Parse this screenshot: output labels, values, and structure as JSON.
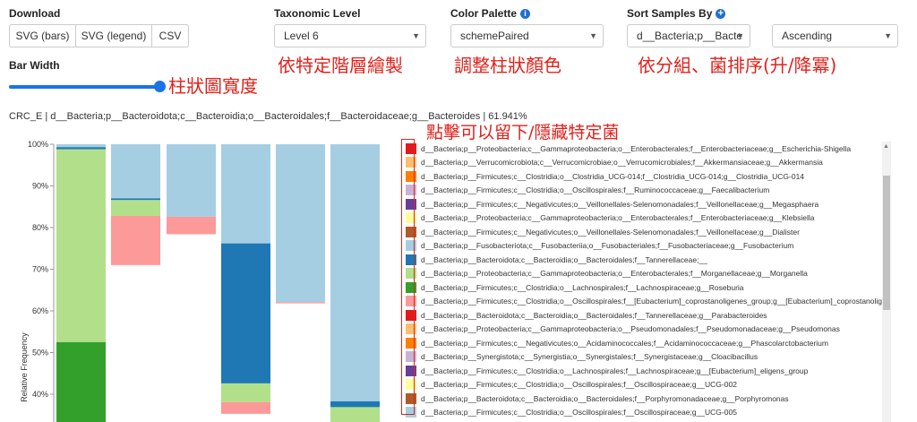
{
  "download": {
    "label": "Download",
    "buttons": [
      "SVG (bars)",
      "SVG (legend)",
      "CSV"
    ]
  },
  "taxonomic_level": {
    "label": "Taxonomic Level",
    "value": "Level 6"
  },
  "color_palette": {
    "label": "Color Palette",
    "value": "schemePaired"
  },
  "sort_samples": {
    "label": "Sort Samples By",
    "value": "d__Bacteria;p__Bacte",
    "order": "Ascending"
  },
  "bar_width": {
    "label": "Bar Width",
    "level": 1.0
  },
  "annotations": {
    "bar_width": "柱狀圖寬度",
    "taxonomic_level": "依特定階層繪製",
    "color_palette": "調整柱狀顏色",
    "sort": "依分組、菌排序(升/降冪)",
    "legend": "點擊可以留下/隱藏特定菌"
  },
  "hover_text": "CRC_E | d__Bacteria;p__Bacteroidota;c__Bacteroidia;o__Bacteroidales;f__Bacteroidaceae;g__Bacteroides | 61.941%",
  "icons": {
    "info": "info-icon",
    "plus": "plus-circle-icon"
  },
  "chart_data": {
    "type": "bar",
    "stacked": true,
    "ylabel": "Relative Frequency",
    "yticks": [
      "100%",
      "90%",
      "80%",
      "70%",
      "60%",
      "50%",
      "40%"
    ],
    "ylim_visible": [
      34.5,
      100
    ],
    "segments": [
      {
        "sample": 0,
        "y0": 99.3,
        "y1": 100,
        "color": "#a6cee3"
      },
      {
        "sample": 0,
        "y0": 98.8,
        "y1": 99.3,
        "color": "#1f78b4"
      },
      {
        "sample": 0,
        "y0": 52.5,
        "y1": 98.8,
        "color": "#b2df8a"
      },
      {
        "sample": 0,
        "y0": 30,
        "y1": 52.5,
        "color": "#33a02c"
      },
      {
        "sample": 1,
        "y0": 87,
        "y1": 100,
        "color": "#a6cee3"
      },
      {
        "sample": 1,
        "y0": 86.6,
        "y1": 87,
        "color": "#1f78b4"
      },
      {
        "sample": 1,
        "y0": 82.8,
        "y1": 86.6,
        "color": "#b2df8a"
      },
      {
        "sample": 1,
        "y0": 71,
        "y1": 82.8,
        "color": "#fb9a99"
      },
      {
        "sample": 2,
        "y0": 82.6,
        "y1": 100,
        "color": "#a6cee3"
      },
      {
        "sample": 2,
        "y0": 78.4,
        "y1": 82.6,
        "color": "#fb9a99"
      },
      {
        "sample": 3,
        "y0": 76.2,
        "y1": 100,
        "color": "#a6cee3"
      },
      {
        "sample": 3,
        "y0": 42.6,
        "y1": 76.2,
        "color": "#1f78b4"
      },
      {
        "sample": 3,
        "y0": 38.1,
        "y1": 42.6,
        "color": "#b2df8a"
      },
      {
        "sample": 3,
        "y0": 35.3,
        "y1": 38.1,
        "color": "#fb9a99"
      },
      {
        "sample": 4,
        "y0": 62.1,
        "y1": 100,
        "color": "#a6cee3"
      },
      {
        "sample": 4,
        "y0": 61.8,
        "y1": 62.1,
        "color": "#fb9a99"
      },
      {
        "sample": 5,
        "y0": 38.3,
        "y1": 100,
        "color": "#a6cee3"
      },
      {
        "sample": 5,
        "y0": 36.9,
        "y1": 38.3,
        "color": "#1f78b4"
      },
      {
        "sample": 5,
        "y0": 30,
        "y1": 36.9,
        "color": "#b2df8a"
      }
    ]
  },
  "legend": [
    {
      "color": "#e31a1c",
      "label": "d__Bacteria;p__Proteobacteria;c__Gammaproteobacteria;o__Enterobacterales;f__Enterobacteriaceae;g__Escherichia-Shigella"
    },
    {
      "color": "#fdbf6f",
      "label": "d__Bacteria;p__Verrucomicrobiota;c__Verrucomicrobiae;o__Verrucomicrobiales;f__Akkermansiaceae;g__Akkermansia"
    },
    {
      "color": "#ff7f00",
      "label": "d__Bacteria;p__Firmicutes;c__Clostridia;o__Clostridia_UCG-014;f__Clostridia_UCG-014;g__Clostridia_UCG-014"
    },
    {
      "color": "#cab2d6",
      "label": "d__Bacteria;p__Firmicutes;c__Clostridia;o__Oscillospirales;f__Ruminococcaceae;g__Faecalibacterium"
    },
    {
      "color": "#6a3d9a",
      "label": "d__Bacteria;p__Firmicutes;c__Negativicutes;o__Veillonellales-Selenomonadales;f__Veillonellaceae;g__Megasphaera"
    },
    {
      "color": "#ffff99",
      "label": "d__Bacteria;p__Proteobacteria;c__Gammaproteobacteria;o__Enterobacterales;f__Enterobacteriaceae;g__Klebsiella"
    },
    {
      "color": "#b15928",
      "label": "d__Bacteria;p__Firmicutes;c__Negativicutes;o__Veillonellales-Selenomonadales;f__Veillonellaceae;g__Dialister"
    },
    {
      "color": "#a6cee3",
      "label": "d__Bacteria;p__Fusobacteriota;c__Fusobacteriia;o__Fusobacteriales;f__Fusobacteriaceae;g__Fusobacterium"
    },
    {
      "color": "#1f78b4",
      "label": "d__Bacteria;p__Bacteroidota;c__Bacteroidia;o__Bacteroidales;f__Tannerellaceae;__"
    },
    {
      "color": "#b2df8a",
      "label": "d__Bacteria;p__Proteobacteria;c__Gammaproteobacteria;o__Enterobacterales;f__Morganellaceae;g__Morganella"
    },
    {
      "color": "#33a02c",
      "label": "d__Bacteria;p__Firmicutes;c__Clostridia;o__Lachnospirales;f__Lachnospiraceae;g__Roseburia"
    },
    {
      "color": "#fb9a99",
      "label": "d__Bacteria;p__Firmicutes;c__Clostridia;o__Oscillospirales;f__[Eubacterium]_coprostanoligenes_group;g__[Eubacterium]_coprostanoligenes_group"
    },
    {
      "color": "#e31a1c",
      "label": "d__Bacteria;p__Bacteroidota;c__Bacteroidia;o__Bacteroidales;f__Tannerellaceae;g__Parabacteroides"
    },
    {
      "color": "#fdbf6f",
      "label": "d__Bacteria;p__Proteobacteria;c__Gammaproteobacteria;o__Pseudomonadales;f__Pseudomonadaceae;g__Pseudomonas"
    },
    {
      "color": "#ff7f00",
      "label": "d__Bacteria;p__Firmicutes;c__Negativicutes;o__Acidaminococcales;f__Acidaminococcaceae;g__Phascolarctobacterium"
    },
    {
      "color": "#cab2d6",
      "label": "d__Bacteria;p__Synergistota;c__Synergistia;o__Synergistales;f__Synergistaceae;g__Cloacibacillus"
    },
    {
      "color": "#6a3d9a",
      "label": "d__Bacteria;p__Firmicutes;c__Clostridia;o__Lachnospirales;f__Lachnospiraceae;g__[Eubacterium]_eligens_group"
    },
    {
      "color": "#ffff99",
      "label": "d__Bacteria;p__Firmicutes;c__Clostridia;o__Oscillospirales;f__Oscillospiraceae;g__UCG-002"
    },
    {
      "color": "#b15928",
      "label": "d__Bacteria;p__Bacteroidota;c__Bacteroidia;o__Bacteroidales;f__Porphyromonadaceae;g__Porphyromonas"
    },
    {
      "color": "#a6cee3",
      "label": "d__Bacteria;p__Firmicutes;c__Clostridia;o__Oscillospirales;f__Oscillospiraceae;g__UCG-005"
    }
  ]
}
